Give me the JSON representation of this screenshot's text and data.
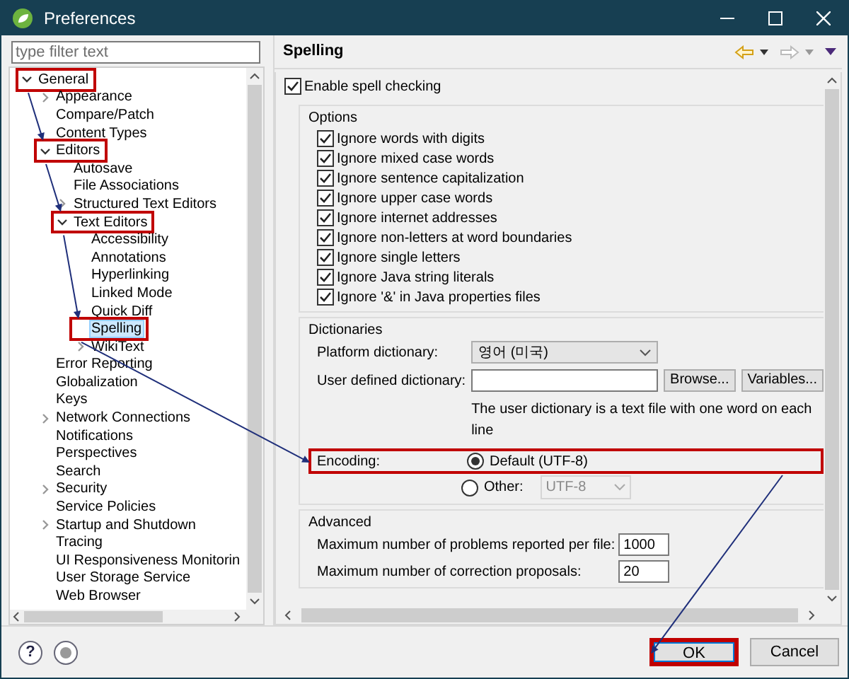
{
  "window": {
    "title": "Preferences"
  },
  "filter": {
    "placeholder": "type filter text"
  },
  "tree": [
    {
      "label": "General",
      "expanded": true,
      "selected": false,
      "highlighted": true,
      "children": [
        {
          "label": "Appearance",
          "expanded": false,
          "selected": false,
          "highlighted": false
        },
        {
          "label": "Compare/Patch",
          "selected": false,
          "highlighted": false
        },
        {
          "label": "Content Types",
          "selected": false,
          "highlighted": false
        },
        {
          "label": "Editors",
          "expanded": true,
          "selected": false,
          "highlighted": true,
          "children": [
            {
              "label": "Autosave",
              "selected": false,
              "highlighted": false
            },
            {
              "label": "File Associations",
              "selected": false,
              "highlighted": false
            },
            {
              "label": "Structured Text Editors",
              "expanded": false,
              "selected": false,
              "highlighted": false
            },
            {
              "label": "Text Editors",
              "expanded": true,
              "selected": false,
              "highlighted": true,
              "children": [
                {
                  "label": "Accessibility",
                  "selected": false,
                  "highlighted": false
                },
                {
                  "label": "Annotations",
                  "selected": false,
                  "highlighted": false
                },
                {
                  "label": "Hyperlinking",
                  "selected": false,
                  "highlighted": false
                },
                {
                  "label": "Linked Mode",
                  "selected": false,
                  "highlighted": false
                },
                {
                  "label": "Quick Diff",
                  "selected": false,
                  "highlighted": false
                },
                {
                  "label": "Spelling",
                  "selected": true,
                  "highlighted": true
                },
                {
                  "label": "WikiText",
                  "expanded": false,
                  "selected": false,
                  "highlighted": false
                }
              ]
            }
          ]
        },
        {
          "label": "Error Reporting",
          "selected": false,
          "highlighted": false
        },
        {
          "label": "Globalization",
          "selected": false,
          "highlighted": false
        },
        {
          "label": "Keys",
          "selected": false,
          "highlighted": false
        },
        {
          "label": "Network Connections",
          "expanded": false,
          "selected": false,
          "highlighted": false
        },
        {
          "label": "Notifications",
          "selected": false,
          "highlighted": false
        },
        {
          "label": "Perspectives",
          "selected": false,
          "highlighted": false
        },
        {
          "label": "Search",
          "selected": false,
          "highlighted": false
        },
        {
          "label": "Security",
          "expanded": false,
          "selected": false,
          "highlighted": false
        },
        {
          "label": "Service Policies",
          "selected": false,
          "highlighted": false
        },
        {
          "label": "Startup and Shutdown",
          "expanded": false,
          "selected": false,
          "highlighted": false
        },
        {
          "label": "Tracing",
          "selected": false,
          "highlighted": false
        },
        {
          "label": "UI Responsiveness Monitorin",
          "selected": false,
          "highlighted": false
        },
        {
          "label": "User Storage Service",
          "selected": false,
          "highlighted": false
        },
        {
          "label": "Web Browser",
          "selected": false,
          "highlighted": false
        }
      ]
    }
  ],
  "page": {
    "title": "Spelling",
    "enable": {
      "label": "Enable spell checking",
      "checked": true
    },
    "options": {
      "title": "Options",
      "items": [
        {
          "label": "Ignore words with digits",
          "checked": true
        },
        {
          "label": "Ignore mixed case words",
          "checked": true
        },
        {
          "label": "Ignore sentence capitalization",
          "checked": true
        },
        {
          "label": "Ignore upper case words",
          "checked": true
        },
        {
          "label": "Ignore internet addresses",
          "checked": true
        },
        {
          "label": "Ignore non-letters at word boundaries",
          "checked": true
        },
        {
          "label": "Ignore single letters",
          "checked": true
        },
        {
          "label": "Ignore Java string literals",
          "checked": true
        },
        {
          "label": "Ignore '&' in Java properties files",
          "checked": true
        }
      ]
    },
    "dictionaries": {
      "title": "Dictionaries",
      "platform": {
        "label": "Platform dictionary:",
        "value": "영어 (미국)"
      },
      "user": {
        "label": "User defined dictionary:",
        "buttons": [
          "Browse...",
          "Variables..."
        ]
      },
      "note": "The user dictionary is a text file with one word on each line",
      "encoding": {
        "label": "Encoding:",
        "highlighted": true,
        "options": [
          {
            "label": "Default (UTF-8)",
            "selected": true
          },
          {
            "label": "Other:",
            "selected": false
          }
        ],
        "other_value": "UTF-8",
        "other_disabled": true
      }
    },
    "advanced": {
      "title": "Advanced",
      "fields": [
        {
          "label": "Maximum number of problems reported per file:",
          "value": "1000"
        },
        {
          "label": "Maximum number of correction proposals:",
          "value": "20"
        }
      ]
    }
  },
  "footer": {
    "help": "?"
  },
  "buttons": [
    {
      "label": "OK",
      "default": true,
      "highlighted": true
    },
    {
      "label": "Cancel",
      "default": false,
      "highlighted": false
    }
  ]
}
